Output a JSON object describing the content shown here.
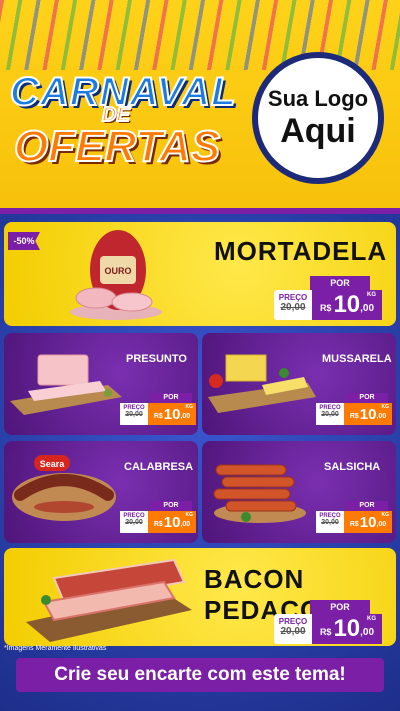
{
  "header": {
    "title_line1": "CARNAVAL",
    "title_line2": "DE",
    "title_line3": "OFERTAS",
    "logo_line1": "Sua Logo",
    "logo_line2": "Aqui"
  },
  "currency": "R$",
  "price_label": "PREÇO",
  "por_label": "POR",
  "unit": "KG",
  "products": [
    {
      "name": "MORTADELA",
      "badge": "-50%",
      "old_price": "20,00",
      "price_int": "10",
      "price_dec": ",00",
      "brand": "OURO"
    },
    {
      "name": "PRESUNTO",
      "old_price": "20,00",
      "price_int": "10",
      "price_dec": ",00"
    },
    {
      "name": "MUSSARELA",
      "old_price": "20,00",
      "price_int": "10",
      "price_dec": ",00"
    },
    {
      "name": "CALABRESA",
      "old_price": "20,00",
      "price_int": "10",
      "price_dec": ",00",
      "brand": "Seara"
    },
    {
      "name": "SALSICHA",
      "old_price": "20,00",
      "price_int": "10",
      "price_dec": ",00"
    },
    {
      "name": "BACON PEDAÇO",
      "old_price": "20,00",
      "price_int": "10",
      "price_dec": ",00"
    }
  ],
  "footnote": "*Imagens Meramente Ilustrativas",
  "banner": "Crie seu encarte com este tema!",
  "colors": {
    "purple": "#7a1fa6",
    "yellow": "#f3cd00",
    "orange": "#ff7a00",
    "blue": "#2a3fa8"
  }
}
